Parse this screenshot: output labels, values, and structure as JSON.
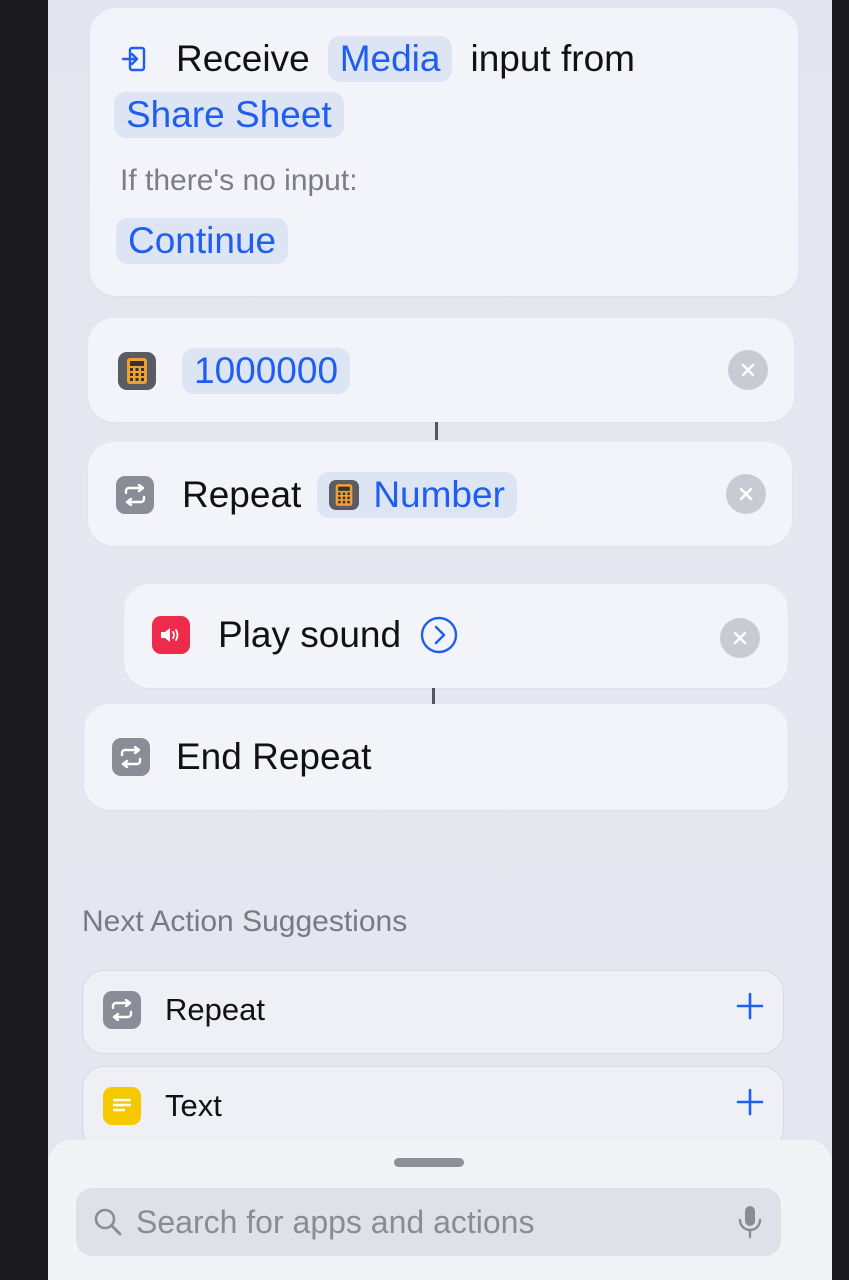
{
  "receive": {
    "receive_label": "Receive",
    "media": "Media",
    "input_from": "input from",
    "share_sheet": "Share Sheet",
    "no_input_label": "If there's no input:",
    "continue": "Continue"
  },
  "number_action": {
    "value": "1000000"
  },
  "repeat_action": {
    "label": "Repeat",
    "variable": "Number"
  },
  "play_sound": {
    "label": "Play sound"
  },
  "end_repeat": {
    "label": "End Repeat"
  },
  "suggestions": {
    "title": "Next Action Suggestions",
    "items": [
      {
        "label": "Repeat",
        "icon": "repeat-icon"
      },
      {
        "label": "Text",
        "icon": "text-icon"
      }
    ]
  },
  "search": {
    "placeholder": "Search for apps and actions"
  },
  "colors": {
    "accent": "#1f5ef0",
    "sound": "#ee2b4b",
    "text_icon": "#f5c800"
  }
}
